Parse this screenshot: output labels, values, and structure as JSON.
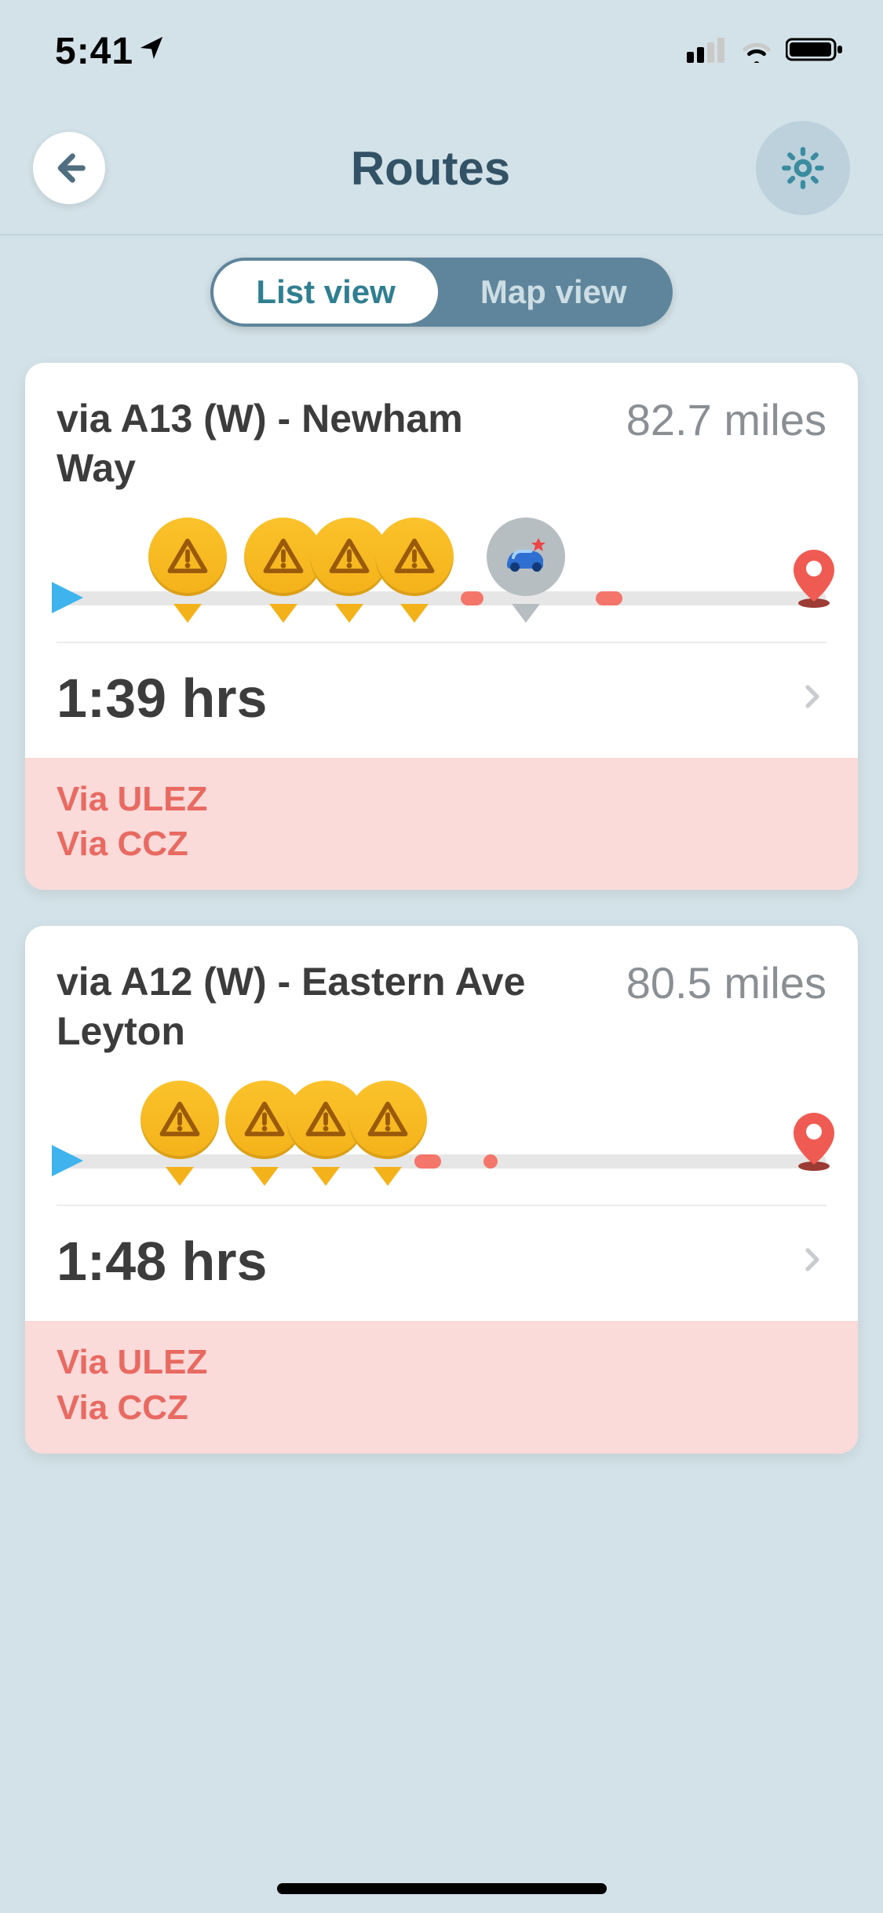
{
  "status": {
    "time": "5:41"
  },
  "header": {
    "title": "Routes"
  },
  "segmented": {
    "list": "List view",
    "map": "Map view",
    "active": "list"
  },
  "routes": [
    {
      "name": "via A13 (W) - Newham Way",
      "distance": "82.7 miles",
      "duration": "1:39 hrs",
      "warnings": [
        "Via ULEZ",
        "Via CCZ"
      ],
      "hazards": [
        {
          "type": "warning",
          "pos": 17
        },
        {
          "type": "warning",
          "pos": 29.5
        },
        {
          "type": "warning",
          "pos": 38
        },
        {
          "type": "warning",
          "pos": 46.5
        },
        {
          "type": "accident",
          "pos": 61
        }
      ],
      "traffic": [
        {
          "pos": 52.5,
          "len": 3
        },
        {
          "pos": 70,
          "len": 3.5
        }
      ]
    },
    {
      "name": "via A12 (W) - Eastern Ave Leyton",
      "distance": "80.5 miles",
      "duration": "1:48 hrs",
      "warnings": [
        "Via ULEZ",
        "Via CCZ"
      ],
      "hazards": [
        {
          "type": "warning",
          "pos": 16
        },
        {
          "type": "warning",
          "pos": 27
        },
        {
          "type": "warning",
          "pos": 35
        },
        {
          "type": "warning",
          "pos": 43
        }
      ],
      "traffic": [
        {
          "pos": 46.5,
          "len": 3.5
        },
        {
          "pos": 55.5,
          "len": 1.8
        }
      ]
    }
  ]
}
